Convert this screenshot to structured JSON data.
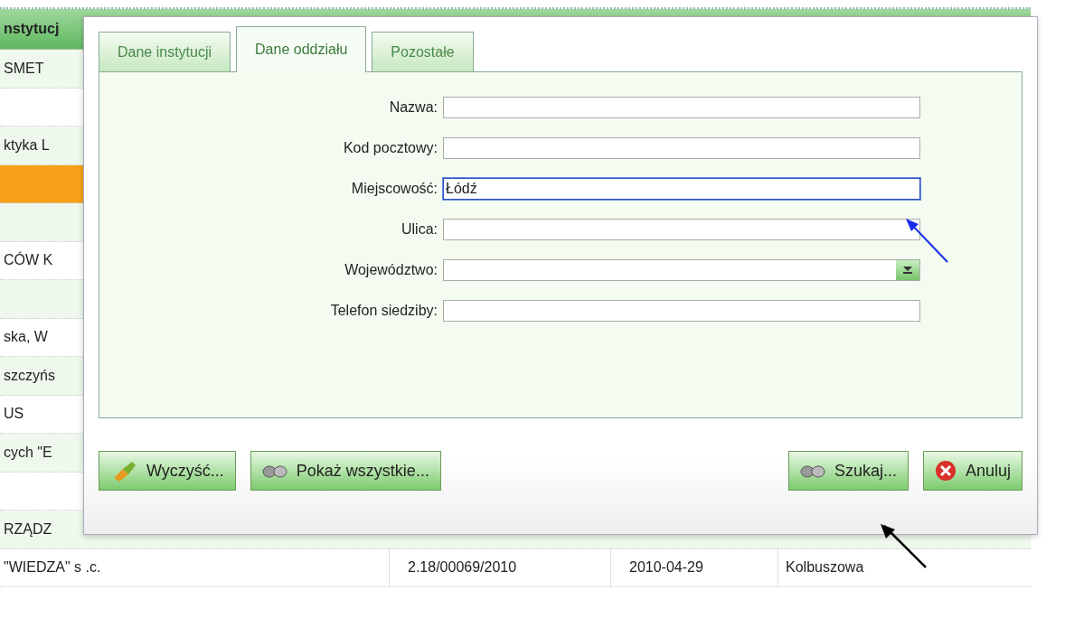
{
  "table": {
    "header": "nstytucj",
    "rows": [
      {
        "cells": [
          "SMET"
        ],
        "selected": false
      },
      {
        "cells": [],
        "selected": false
      },
      {
        "cells": [
          "ktyka L"
        ],
        "selected": false
      },
      {
        "cells": [],
        "selected": true
      },
      {
        "cells": [],
        "selected": false
      },
      {
        "cells": [
          "CÓW K"
        ],
        "selected": false
      },
      {
        "cells": [],
        "selected": false
      },
      {
        "cells": [
          "ska, W"
        ],
        "selected": false
      },
      {
        "cells": [
          "szczyńs"
        ],
        "selected": false
      },
      {
        "cells": [
          "US"
        ],
        "selected": false
      },
      {
        "cells": [
          "cych \"E"
        ],
        "selected": false
      },
      {
        "cells": [],
        "selected": false
      },
      {
        "cells": [
          "RZĄDZ"
        ],
        "selected": false
      },
      {
        "cells": [
          "\"WIEDZA\" s .c.",
          "2.18/00069/2010",
          "2010-04-29",
          "Kolbuszowa"
        ],
        "selected": false
      }
    ]
  },
  "dialog": {
    "tabs": [
      {
        "label": "Dane instytucji",
        "selected": false
      },
      {
        "label": "Dane oddziału",
        "selected": true
      },
      {
        "label": "Pozostałe",
        "selected": false
      }
    ],
    "fields": [
      {
        "label": "Nazwa:",
        "kind": "text",
        "focused": false
      },
      {
        "label": "Kod pocztowy:",
        "kind": "text",
        "focused": false
      },
      {
        "label": "Miejscowość:",
        "kind": "text",
        "value": "Łódź",
        "focused": true
      },
      {
        "label": "Ulica:",
        "kind": "text",
        "focused": false
      },
      {
        "label": "Województwo:",
        "kind": "dropdown",
        "focused": false
      },
      {
        "label": "Telefon siedziby:",
        "kind": "text",
        "focused": false
      }
    ],
    "left_buttons": [
      {
        "label": "Wyczyść...",
        "kind": "clear"
      },
      {
        "label": "Pokaż wszystkie...",
        "kind": "show_all"
      }
    ],
    "right_buttons": [
      {
        "label": "Szukaj...",
        "kind": "search"
      },
      {
        "label": "Anuluj",
        "kind": "cancel"
      }
    ]
  }
}
